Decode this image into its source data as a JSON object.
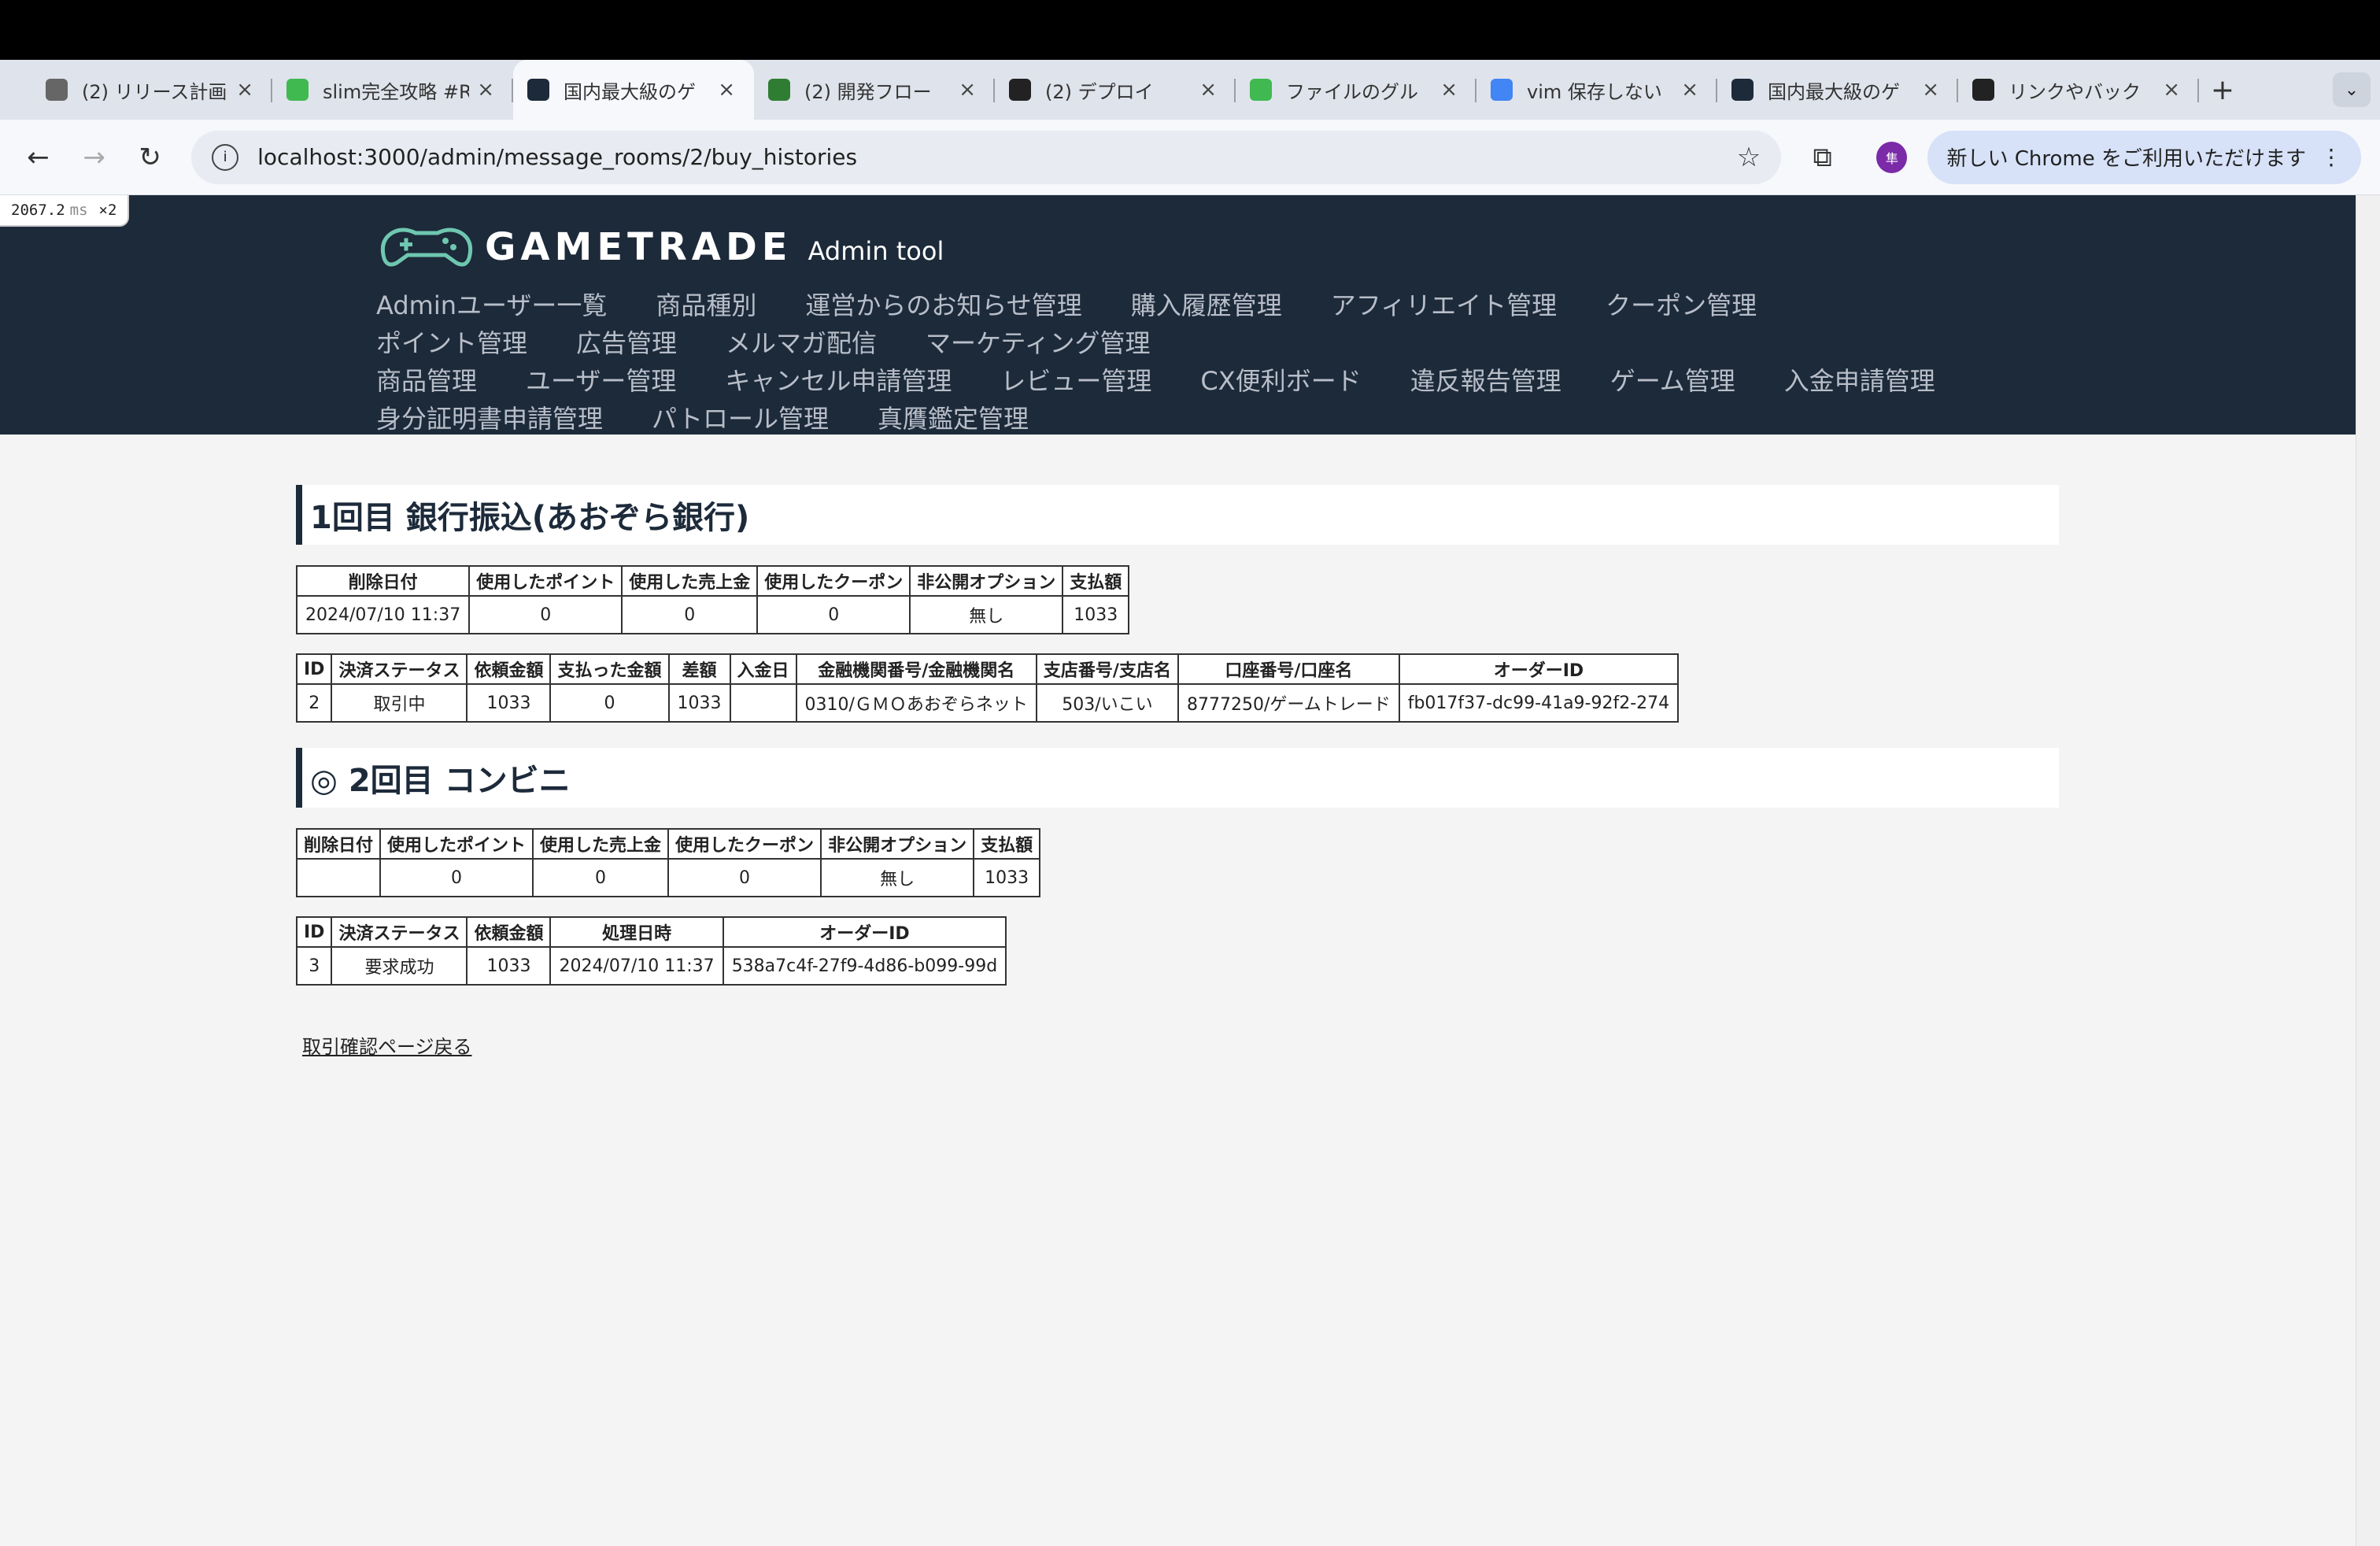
{
  "browser": {
    "tabs": [
      {
        "title": "(2) リリース計画",
        "color": "#666666"
      },
      {
        "title": "slim完全攻略 #R",
        "color": "#3fb950"
      },
      {
        "title": "国内最大級のゲ",
        "color": "#1c2a3a",
        "active": true
      },
      {
        "title": "(2) 開発フロー",
        "color": "#2f7d32"
      },
      {
        "title": "(2) デプロイ",
        "color": "#222222"
      },
      {
        "title": "ファイルのグル",
        "color": "#3fb950"
      },
      {
        "title": "vim 保存しない",
        "color": "#4285f4"
      },
      {
        "title": "国内最大級のゲ",
        "color": "#1c2a3a"
      },
      {
        "title": "リンクやバック",
        "color": "#222222"
      }
    ],
    "new_tab": "+",
    "tab_close": "×",
    "url": "localhost:3000/admin/message_rooms/2/buy_histories",
    "profile_initial": "隼",
    "update_label": "新しい Chrome をご利用いただけます"
  },
  "perf_badge": {
    "value": "2067.2",
    "unit": "ms",
    "multiplier": "×2"
  },
  "header": {
    "brand": "GAMETRADE",
    "subtitle": "Admin tool",
    "nav_rows": [
      [
        "Adminユーザー一覧",
        "商品種別",
        "運営からのお知らせ管理",
        "購入履歴管理",
        "アフィリエイト管理",
        "クーポン管理"
      ],
      [
        "ポイント管理",
        "広告管理",
        "メルマガ配信",
        "マーケティング管理"
      ],
      [
        "商品管理",
        "ユーザー管理",
        "キャンセル申請管理",
        "レビュー管理",
        "CX便利ボード",
        "違反報告管理",
        "ゲーム管理",
        "入金申請管理"
      ],
      [
        "身分証明書申請管理",
        "パトロール管理",
        "真贋鑑定管理"
      ]
    ]
  },
  "sections": [
    {
      "title": "1回目 銀行振込(あおぞら銀行)",
      "summary_headers": [
        "削除日付",
        "使用したポイント",
        "使用した売上金",
        "使用したクーポン",
        "非公開オプション",
        "支払額"
      ],
      "summary_row": [
        "2024/07/10 11:37",
        "0",
        "0",
        "0",
        "無し",
        "1033"
      ],
      "detail_headers": [
        "ID",
        "決済ステータス",
        "依頼金額",
        "支払った金額",
        "差額",
        "入金日",
        "金融機関番号/金融機関名",
        "支店番号/支店名",
        "口座番号/口座名",
        "オーダーID"
      ],
      "detail_row": [
        "2",
        "取引中",
        "1033",
        "0",
        "1033",
        "",
        "0310/ＧＭＯあおぞらネット",
        "503/いこい",
        "8777250/ゲームトレード",
        "fb017f37-dc99-41a9-92f2-274"
      ]
    },
    {
      "title": "◎ 2回目 コンビニ",
      "summary_headers": [
        "削除日付",
        "使用したポイント",
        "使用した売上金",
        "使用したクーポン",
        "非公開オプション",
        "支払額"
      ],
      "summary_row": [
        "",
        "0",
        "0",
        "0",
        "無し",
        "1033"
      ],
      "detail_headers": [
        "ID",
        "決済ステータス",
        "依頼金額",
        "処理日時",
        "オーダーID"
      ],
      "detail_row": [
        "3",
        "要求成功",
        "1033",
        "2024/07/10 11:37",
        "538a7c4f-27f9-4d86-b099-99d"
      ]
    }
  ],
  "back_link": "取引確認ページ戻る"
}
